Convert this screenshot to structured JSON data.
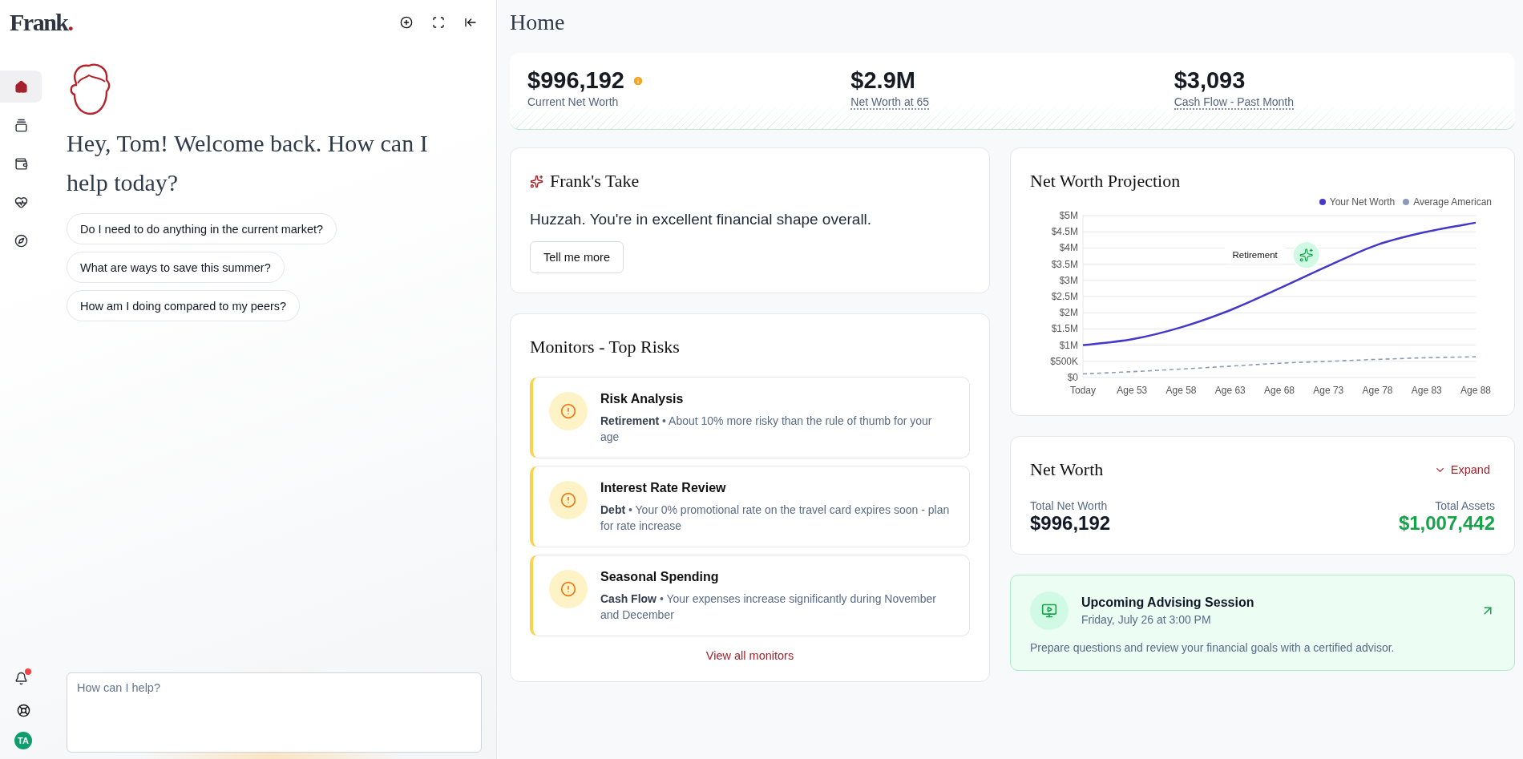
{
  "logo": {
    "name": "Frank",
    "mark": "."
  },
  "nav": [
    {
      "selected": true
    },
    {
      "selected": false
    },
    {
      "selected": false
    },
    {
      "selected": false
    },
    {
      "selected": false
    }
  ],
  "notifications": {
    "unread": true
  },
  "user": {
    "initials": "TA"
  },
  "chat": {
    "greeting": "Hey, Tom! Welcome back. How can I help today?",
    "suggestions": [
      "Do I need to do anything in the current market?",
      "What are ways to save this summer?",
      "How am I doing compared to my peers?"
    ],
    "input": {
      "placeholder": "How can I help?"
    }
  },
  "page": {
    "title": "Home"
  },
  "stats": [
    {
      "value": "$996,192",
      "label": "Current Net Worth",
      "info": true,
      "dotted": false
    },
    {
      "value": "$2.9M",
      "label": "Net Worth at 65",
      "info": false,
      "dotted": true
    },
    {
      "value": "$3,093",
      "label": "Cash Flow - Past Month",
      "info": false,
      "dotted": true
    }
  ],
  "franks_take": {
    "title": "Frank's Take",
    "message": "Huzzah. You're in excellent financial shape overall.",
    "button": "Tell me more"
  },
  "monitors": {
    "title": "Monitors - Top Risks",
    "separator": "•",
    "items": [
      {
        "title": "Risk Analysis",
        "category": "Retirement",
        "description": "About 10% more risky than the rule of thumb for your age"
      },
      {
        "title": "Interest Rate Review",
        "category": "Debt",
        "description": "Your 0% promotional rate on the travel card expires soon - plan for rate increase"
      },
      {
        "title": "Seasonal Spending",
        "category": "Cash Flow",
        "description": "Your expenses increase significantly during November and December"
      }
    ],
    "link": "View all monitors"
  },
  "projection": {
    "title": "Net Worth Projection",
    "chart_data": {
      "type": "line",
      "grid": true,
      "legend": true,
      "categories": [
        "Today",
        "Age 53",
        "Age 58",
        "Age 63",
        "Age 68",
        "Age 73",
        "Age 78",
        "Age 83",
        "Age 88"
      ],
      "series": [
        {
          "name": "Your Net Worth",
          "color": "#4338ca",
          "line_style": "solid",
          "values": [
            1000000,
            1180000,
            1550000,
            2080000,
            2750000,
            3450000,
            4100000,
            4500000,
            4780000
          ]
        },
        {
          "name": "Average American",
          "color": "#8a9bb5",
          "line_style": "dashed",
          "values": [
            110000,
            180000,
            260000,
            350000,
            440000,
            500000,
            560000,
            610000,
            640000
          ]
        }
      ],
      "ylim": [
        0,
        5000000
      ],
      "yticks": [
        {
          "value": 0,
          "label": "$0"
        },
        {
          "value": 500000,
          "label": "$500K"
        },
        {
          "value": 1000000,
          "label": "$1M"
        },
        {
          "value": 1500000,
          "label": "$1.5M"
        },
        {
          "value": 2000000,
          "label": "$2M"
        },
        {
          "value": 2500000,
          "label": "$2.5M"
        },
        {
          "value": 3000000,
          "label": "$3M"
        },
        {
          "value": 3500000,
          "label": "$3.5M"
        },
        {
          "value": 4000000,
          "label": "$4M"
        },
        {
          "value": 4500000,
          "label": "$4.5M"
        },
        {
          "value": 5000000,
          "label": "$5M"
        }
      ],
      "annotations": [
        "Retirement"
      ]
    }
  },
  "net_worth": {
    "title": "Net Worth",
    "expand": "Expand",
    "total_label": "Total Net Worth",
    "total": "$996,192",
    "assets_label": "Total Assets",
    "assets": "$1,007,442"
  },
  "session": {
    "title": "Upcoming Advising Session",
    "when": "Friday, July 26 at 3:00 PM",
    "description": "Prepare questions and review your financial goals with a certified advisor."
  }
}
